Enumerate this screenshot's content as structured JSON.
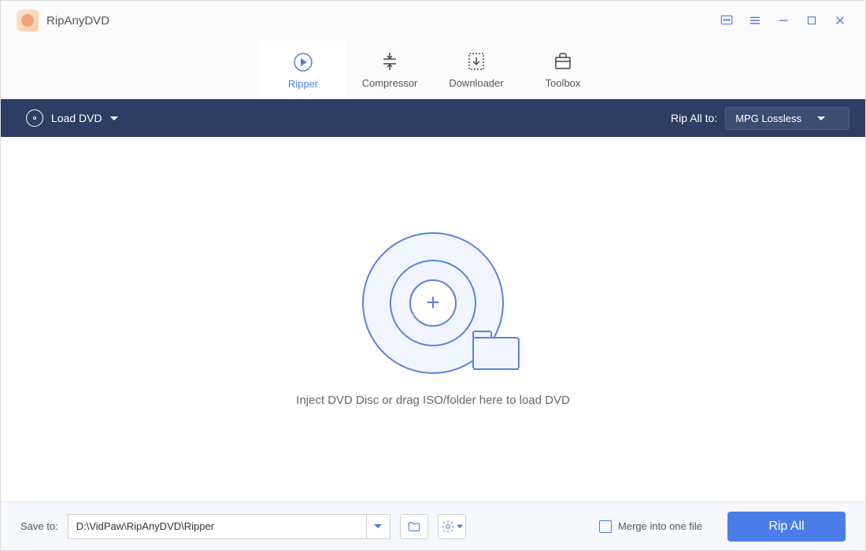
{
  "app": {
    "title": "RipAnyDVD"
  },
  "tabs": {
    "ripper": "Ripper",
    "compressor": "Compressor",
    "downloader": "Downloader",
    "toolbox": "Toolbox"
  },
  "actionbar": {
    "load_label": "Load DVD",
    "ripall_to_label": "Rip All to:",
    "format_selected": "MPG Lossless"
  },
  "main": {
    "instruction": "Inject DVD Disc or drag ISO/folder here to load DVD"
  },
  "footer": {
    "saveto_label": "Save to:",
    "path_value": "D:\\VidPaw\\RipAnyDVD\\Ripper",
    "merge_label": "Merge into one file",
    "ripall_label": "Rip All"
  }
}
